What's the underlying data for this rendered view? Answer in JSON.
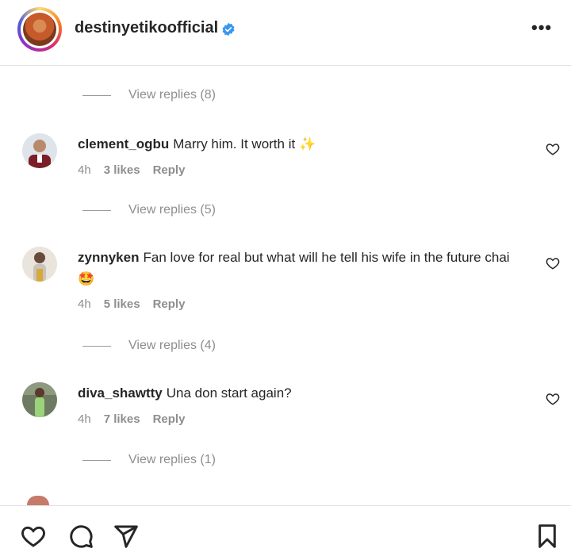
{
  "header": {
    "username": "destinyetikoofficial",
    "verified": true,
    "more_label": "•••"
  },
  "replies_top": {
    "label": "View replies (8)"
  },
  "comments": [
    {
      "username": "clement_ogbu",
      "text": "Marry him. It worth it",
      "emoji": "✨",
      "time": "4h",
      "likes": "3 likes",
      "reply": "Reply",
      "view_replies": "View replies (5)"
    },
    {
      "username": "zynnyken",
      "text": "Fan love for real but what will he tell his wife in the future chai",
      "emoji": "🤩",
      "time": "4h",
      "likes": "5 likes",
      "reply": "Reply",
      "view_replies": "View replies (4)"
    },
    {
      "username": "diva_shawtty",
      "text": "Una don start again?",
      "emoji": "",
      "time": "4h",
      "likes": "7 likes",
      "reply": "Reply",
      "view_replies": "View replies (1)"
    }
  ],
  "icons": {
    "header": [
      "avatar",
      "verified-badge-icon",
      "more-options-icon"
    ],
    "footer": [
      "heart-icon",
      "comment-icon",
      "share-icon",
      "bookmark-icon"
    ]
  },
  "colors": {
    "verified": "#3897f0",
    "muted": "#8e8e8e",
    "text": "#262626"
  }
}
